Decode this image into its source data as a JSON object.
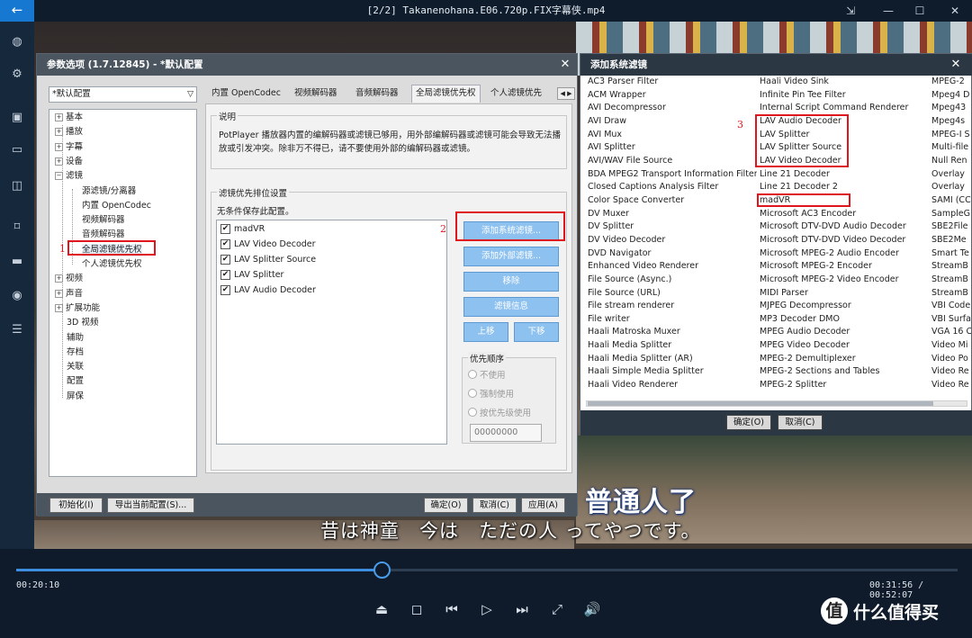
{
  "window": {
    "title": "[2/2] Takanenohana.E06.720p.FIX字幕侠.mp4",
    "back_icon": "←",
    "pin_icon": "⇲",
    "minimize_icon": "—",
    "maximize_icon": "☐",
    "close_icon": "✕"
  },
  "sidebar": {
    "icons": [
      "palette-icon",
      "settings-icon",
      "remote-icon",
      "chat-icon",
      "layers-icon",
      "bookmark-icon",
      "device-icon",
      "screenshot-icon",
      "playlist-icon"
    ],
    "glyphs": [
      "◍",
      "⚙",
      "▣",
      "▭",
      "◫",
      "⌑",
      "▬",
      "◉",
      "☰"
    ]
  },
  "subtitles": {
    "cn": "普通人了",
    "jp": "昔は神童　今は　ただの人 ってやつです。"
  },
  "player": {
    "time_current": "00:20:10",
    "time_total": "00:31:56 / 00:52:07",
    "progress": 0.388,
    "controls": [
      "⏏",
      "◻",
      "⏮",
      "▷",
      "⏭",
      "⤢",
      "🔊"
    ],
    "control_names": [
      "eject-icon",
      "stop-icon",
      "prev-icon",
      "play-icon",
      "next-icon",
      "fullscreen-icon",
      "volume-icon"
    ]
  },
  "watermark": {
    "icon": "值",
    "text": "什么值得买"
  },
  "prefs": {
    "title": "参数选项 (1.7.12845) - *默认配置",
    "close": "✕",
    "profile": "*默认配置",
    "profile_arrow": "▽",
    "tree": [
      {
        "label": "基本",
        "plus": true
      },
      {
        "label": "播放",
        "plus": true
      },
      {
        "label": "字幕",
        "plus": true
      },
      {
        "label": "设备",
        "plus": true
      },
      {
        "label": "滤镜",
        "plus": true
      },
      {
        "label": "源滤镜/分离器",
        "child": true
      },
      {
        "label": "内置 OpenCodec",
        "child": true
      },
      {
        "label": "视频解码器",
        "child": true
      },
      {
        "label": "音频解码器",
        "child": true
      },
      {
        "label": "全局滤镜优先权",
        "child": true
      },
      {
        "label": "个人滤镜优先权",
        "child": true
      },
      {
        "label": "视频",
        "plus": true
      },
      {
        "label": "声音",
        "plus": true
      },
      {
        "label": "扩展功能",
        "plus": true
      },
      {
        "label": "3D 视频"
      },
      {
        "label": "辅助"
      },
      {
        "label": "存档"
      },
      {
        "label": "关联"
      },
      {
        "label": "配置"
      },
      {
        "label": "屏保"
      }
    ],
    "tabs": [
      "内置 OpenCodec",
      "视频解码器",
      "音频解码器",
      "全局滤镜优先权",
      "个人滤镜优先"
    ],
    "tab_scroll": "◀ ▶",
    "desc_group": "说明",
    "desc_text": "PotPlayer 播放器内置的编解码器或滤镜已够用，用外部编解码器或滤镜可能会导致无法播放或引发冲突。除非万不得已，请不要使用外部的编解码器或滤镜。",
    "order_group": "滤镜优先排位设置",
    "order_note": "无条件保存此配置。",
    "filters": [
      "madVR",
      "LAV Video Decoder",
      "LAV Splitter Source",
      "LAV Splitter",
      "LAV Audio Decoder"
    ],
    "check": "✔",
    "buttons": {
      "add_system": "添加系统滤镜...",
      "add_external": "添加外部滤镜...",
      "remove": "移除",
      "info": "滤镜信息",
      "up": "上移",
      "down": "下移"
    },
    "priority_group": "优先顺序",
    "priority_options": [
      "不使用",
      "强制使用",
      "按优先级使用"
    ],
    "priority_value": "00000000",
    "bottom": {
      "init": "初始化(I)",
      "export": "导出当前配置(S)...",
      "ok": "确定(O)",
      "cancel": "取消(C)",
      "apply": "应用(A)"
    },
    "markers": [
      "1",
      "2"
    ]
  },
  "add_filter": {
    "title": "添加系统滤镜",
    "close": "✕",
    "col1": [
      "AC3 Parser Filter",
      "ACM Wrapper",
      "AVI Decompressor",
      "AVI Draw",
      "AVI Mux",
      "AVI Splitter",
      "AVI/WAV File Source",
      "BDA MPEG2 Transport Information Filter",
      "Closed Captions Analysis Filter",
      "Color Space Converter",
      "DV Muxer",
      "DV Splitter",
      "DV Video Decoder",
      "DVD Navigator",
      "Enhanced Video Renderer",
      "File Source (Async.)",
      "File Source (URL)",
      "File stream renderer",
      "File writer",
      "Haali Matroska Muxer",
      "Haali Media Splitter",
      "Haali Media Splitter (AR)",
      "Haali Simple Media Splitter",
      "Haali Video Renderer"
    ],
    "col2": [
      "Haali Video Sink",
      "Infinite Pin Tee Filter",
      "Internal Script Command Renderer",
      "LAV Audio Decoder",
      "LAV Splitter",
      "LAV Splitter Source",
      "LAV Video Decoder",
      "Line 21 Decoder",
      "Line 21 Decoder 2",
      "madVR",
      "Microsoft AC3 Encoder",
      "Microsoft DTV-DVD Audio Decoder",
      "Microsoft DTV-DVD Video Decoder",
      "Microsoft MPEG-2 Audio Encoder",
      "Microsoft MPEG-2 Encoder",
      "Microsoft MPEG-2 Video Encoder",
      "MIDI Parser",
      "MJPEG Decompressor",
      "MP3 Decoder DMO",
      "MPEG Audio Decoder",
      "MPEG Video Decoder",
      "MPEG-2 Demultiplexer",
      "MPEG-2 Sections and Tables",
      "MPEG-2 Splitter"
    ],
    "col3": [
      "MPEG-2",
      "Mpeg4 D",
      "Mpeg43",
      "Mpeg4s",
      "MPEG-I S",
      "Multi-file",
      "Null Ren",
      "Overlay",
      "Overlay",
      "SAMI (CC",
      "SampleG",
      "SBE2File",
      "SBE2Me",
      "Smart Te",
      "StreamB",
      "StreamB",
      "StreamB",
      "VBI Code",
      "VBI Surfa",
      "VGA 16 C",
      "Video Mi",
      "Video Po",
      "Video Re",
      "Video Re"
    ],
    "ok": "确定(O)",
    "cancel": "取消(C)",
    "marker": "3"
  }
}
